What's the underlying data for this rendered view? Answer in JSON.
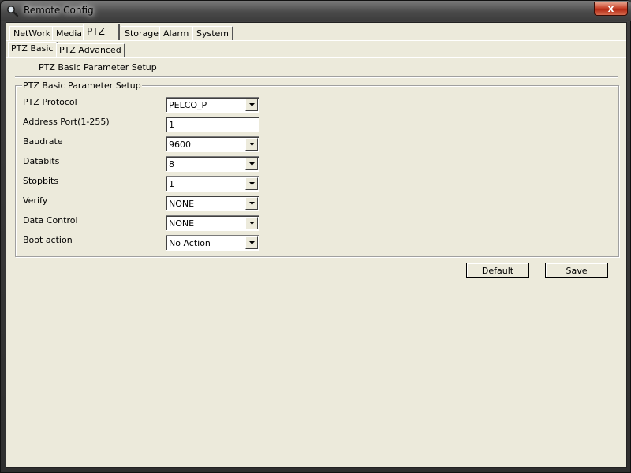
{
  "window": {
    "title": "Remote Config",
    "close_label": "x"
  },
  "main_tabs": [
    {
      "label": "NetWork"
    },
    {
      "label": "Media"
    },
    {
      "label": "PTZ"
    },
    {
      "label": "Storage"
    },
    {
      "label": "Alarm"
    },
    {
      "label": "System"
    }
  ],
  "active_main_tab": "PTZ",
  "sub_tabs": [
    {
      "label": "PTZ Basic"
    },
    {
      "label": "PTZ Advanced"
    }
  ],
  "active_sub_tab": "PTZ Basic",
  "section_title": "PTZ Basic Parameter Setup",
  "group": {
    "legend": "PTZ Basic Parameter Setup",
    "fields": [
      {
        "label": "PTZ Protocol",
        "value": "PELCO_P",
        "type": "combo"
      },
      {
        "label": "Address Port(1-255)",
        "value": "1",
        "type": "text"
      },
      {
        "label": "Baudrate",
        "value": "9600",
        "type": "combo"
      },
      {
        "label": "Databits",
        "value": "8",
        "type": "combo"
      },
      {
        "label": "Stopbits",
        "value": "1",
        "type": "combo"
      },
      {
        "label": "Verify",
        "value": "NONE",
        "type": "combo"
      },
      {
        "label": "Data Control",
        "value": "NONE",
        "type": "combo"
      },
      {
        "label": "Boot action",
        "value": "No Action",
        "type": "combo"
      }
    ]
  },
  "buttons": {
    "default_label": "Default",
    "save_label": "Save"
  },
  "icons": {
    "app": "magnifier-icon",
    "close": "close-icon",
    "dropdown": "chevron-down-icon"
  }
}
